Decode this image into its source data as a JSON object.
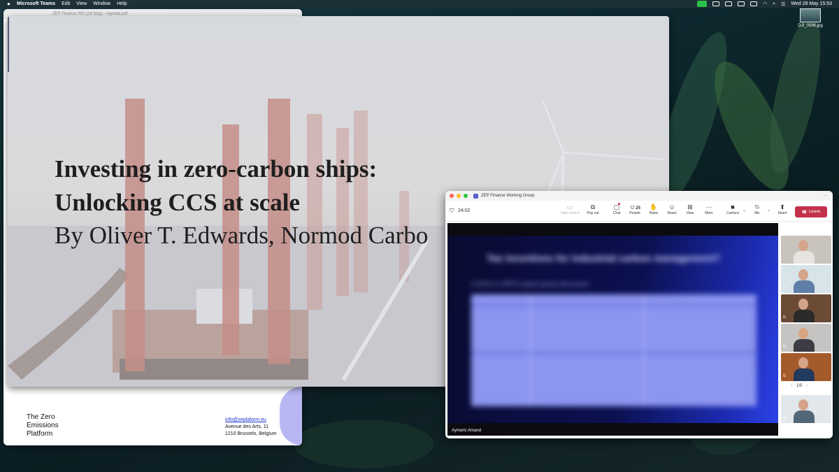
{
  "menubar": {
    "app_name": "Microsoft Teams",
    "items": [
      "Edit",
      "View",
      "Window",
      "Help"
    ],
    "datetime": "Wed 28 May  15:53"
  },
  "desktop": {
    "file_name": "DJI_0596.jpg"
  },
  "pdf": {
    "title": "ZEP Finance WG (28 May) - Agenda.pdf",
    "org_name": "The Zero Emissions Platform",
    "contact_email": "info@zeplaform.eu",
    "address_1": "Avenue des Arts, 11",
    "address_2": "1210 Brussels, Belgium"
  },
  "slide": {
    "title_line_1": "Investing in zero-carbon ships:",
    "title_line_2": "Unlocking CCS at scale",
    "byline": "By Oliver T. Edwards, Normod Carbo"
  },
  "teams": {
    "window_title": "ZEP Finance Working Group",
    "timer": "24:02",
    "toolbar": {
      "take_control": "Take control",
      "pop_out": "Pop out",
      "chat": "Chat",
      "people": "People",
      "people_count": "25",
      "raise": "Raise",
      "react": "React",
      "view": "View",
      "more": "More",
      "camera": "Camera",
      "mic": "Mic",
      "share": "Share",
      "leave": "Leave"
    },
    "shared": {
      "title": "Tax incentives for industrial carbon management?",
      "subtitle": "CODIS in CRPS support group discussion"
    },
    "speaker_name": "Aymeric Amand",
    "pager": "1/5"
  },
  "colors": {
    "leave_red": "#c4314b",
    "teams_purple": "#5b5fc7",
    "zep_lavender": "#b9b7f3"
  }
}
